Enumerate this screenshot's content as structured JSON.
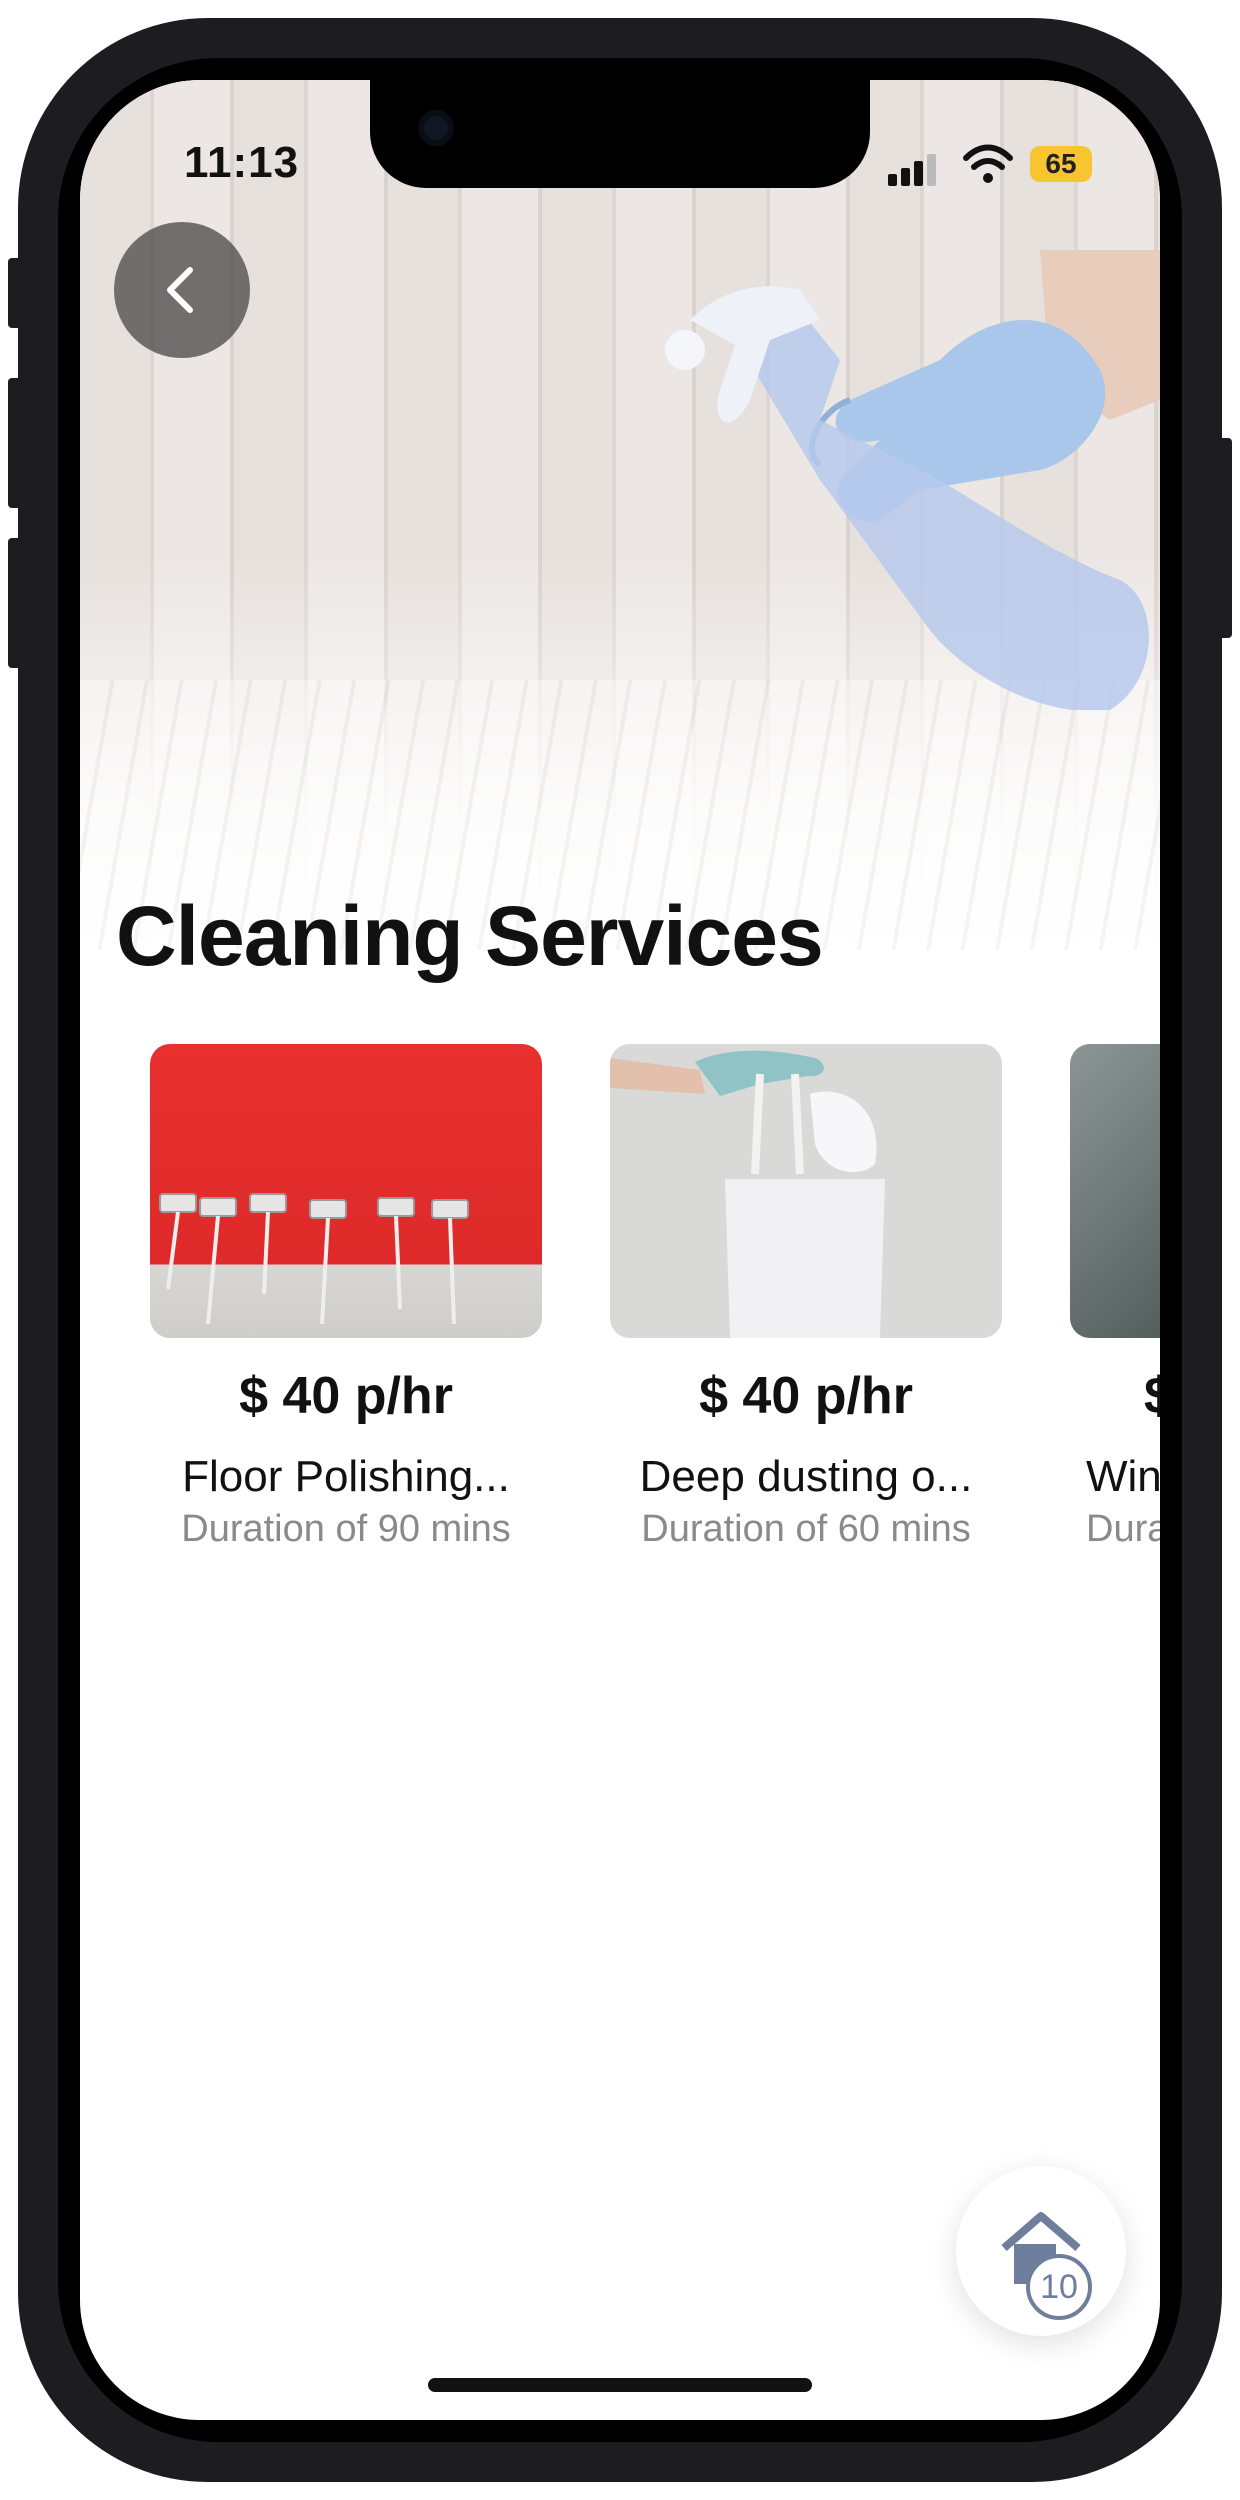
{
  "status_bar": {
    "time": "11:13",
    "battery": "65"
  },
  "header": {
    "title": "Cleaning Services"
  },
  "icons": {
    "back": "chevron-left-icon",
    "cart": "home-cart-icon"
  },
  "services": [
    {
      "price": "$ 40 p/hr",
      "name": "Floor Polishing...",
      "duration": "Duration of 90 mins",
      "image": "red-wall-mops"
    },
    {
      "price": "$ 40 p/hr",
      "name": "Deep dusting o...",
      "duration": "Duration of 60 mins",
      "image": "gloved-hand-bag-duster"
    },
    {
      "price": "$",
      "name": "Win",
      "duration": "Dura",
      "image": "dark-window"
    }
  ],
  "cart": {
    "count": "10"
  },
  "colors": {
    "accent_icon": "#6e7e9c",
    "text": "#111111",
    "muted": "#8a8a8e",
    "battery": "#f6c530"
  }
}
